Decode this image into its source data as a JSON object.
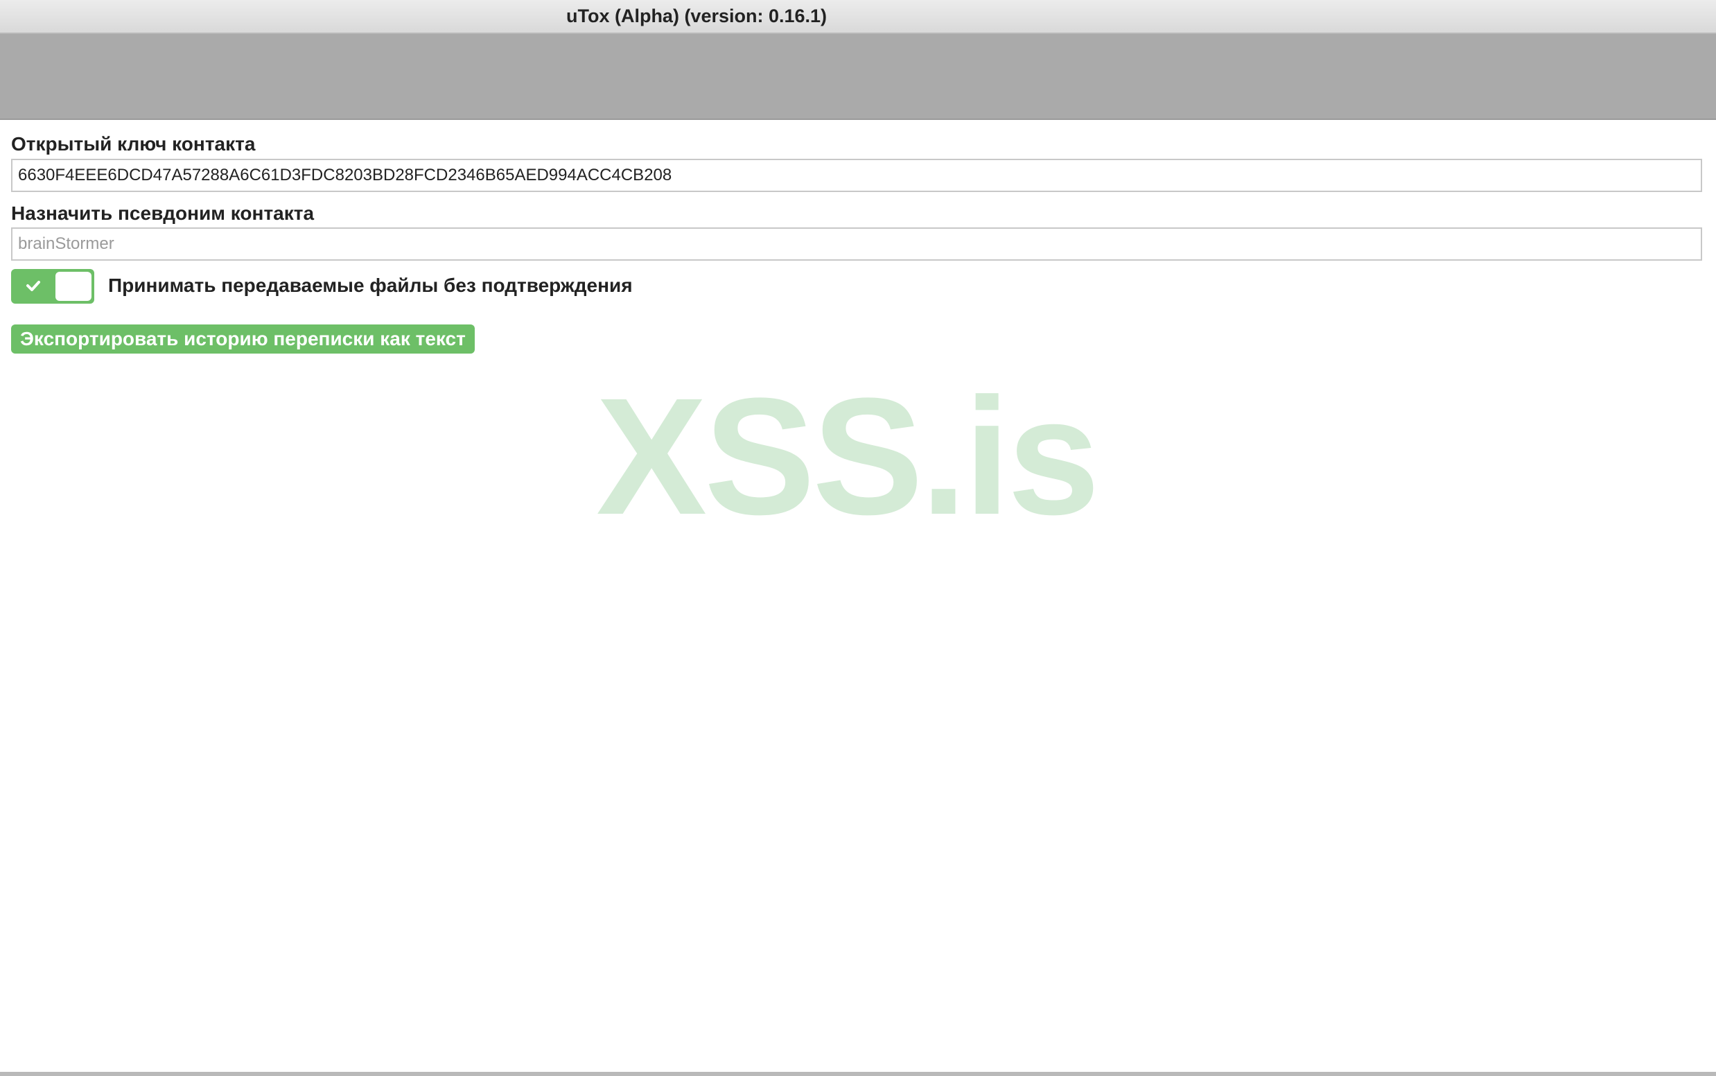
{
  "window": {
    "title": "uTox (Alpha) (version: 0.16.1)"
  },
  "public_key": {
    "label": "Открытый ключ контакта",
    "value": "6630F4EEE6DCD47A57288A6C61D3FDC8203BD28FCD2346B65AED994ACC4CB208"
  },
  "alias": {
    "label": "Назначить псевдоним контакта",
    "value": "",
    "placeholder": "brainStormer"
  },
  "auto_accept": {
    "label": "Принимать передаваемые файлы без подтверждения",
    "enabled": true
  },
  "export_button": {
    "label": "Экспортировать историю переписки как текст"
  },
  "watermark": {
    "text": "XSS.is"
  },
  "colors": {
    "accent": "#6dbf67",
    "header_band": "#aaaaaa",
    "watermark": "#d4ebd6"
  },
  "icons": {
    "toggle_check": "check-icon"
  }
}
